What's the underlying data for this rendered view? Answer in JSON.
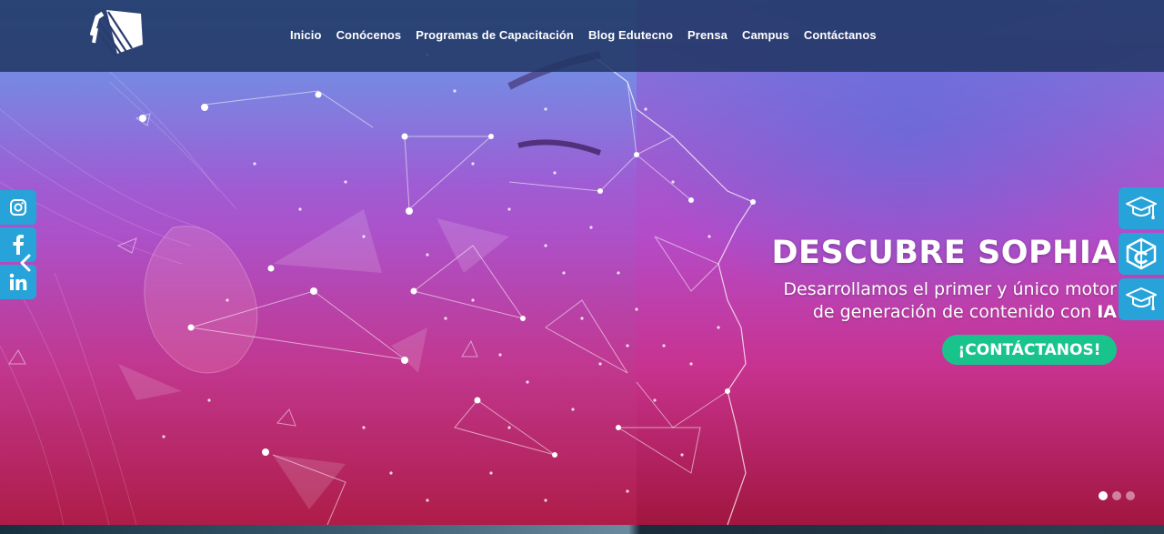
{
  "nav": {
    "items": [
      {
        "label": "Inicio"
      },
      {
        "label": "Conócenos"
      },
      {
        "label": "Programas de Capacitación"
      },
      {
        "label": "Blog Edutecno"
      },
      {
        "label": "Prensa"
      },
      {
        "label": "Campus"
      },
      {
        "label": "Contáctanos"
      }
    ]
  },
  "hero": {
    "headline": "DESCUBRE SOPHIA",
    "sub_line1": "Desarrollamos el primer y único motor",
    "sub_line2_prefix": "de generación de contenido con ",
    "sub_line2_bold": "IA",
    "cta_label": "¡CONTÁCTANOS!",
    "slides_total": 3,
    "active_slide": 1
  },
  "social": {
    "icons": [
      "instagram-icon",
      "facebook-icon",
      "linkedin-icon"
    ]
  },
  "side_buttons": {
    "icons": [
      "graduation-cap-icon",
      "cube-logo-icon",
      "graduation-cap-icon"
    ]
  },
  "colors": {
    "navbar": "#213462",
    "accent_blue": "#27a3d9",
    "cta_green": "#19c48c",
    "text": "#ffffff"
  }
}
